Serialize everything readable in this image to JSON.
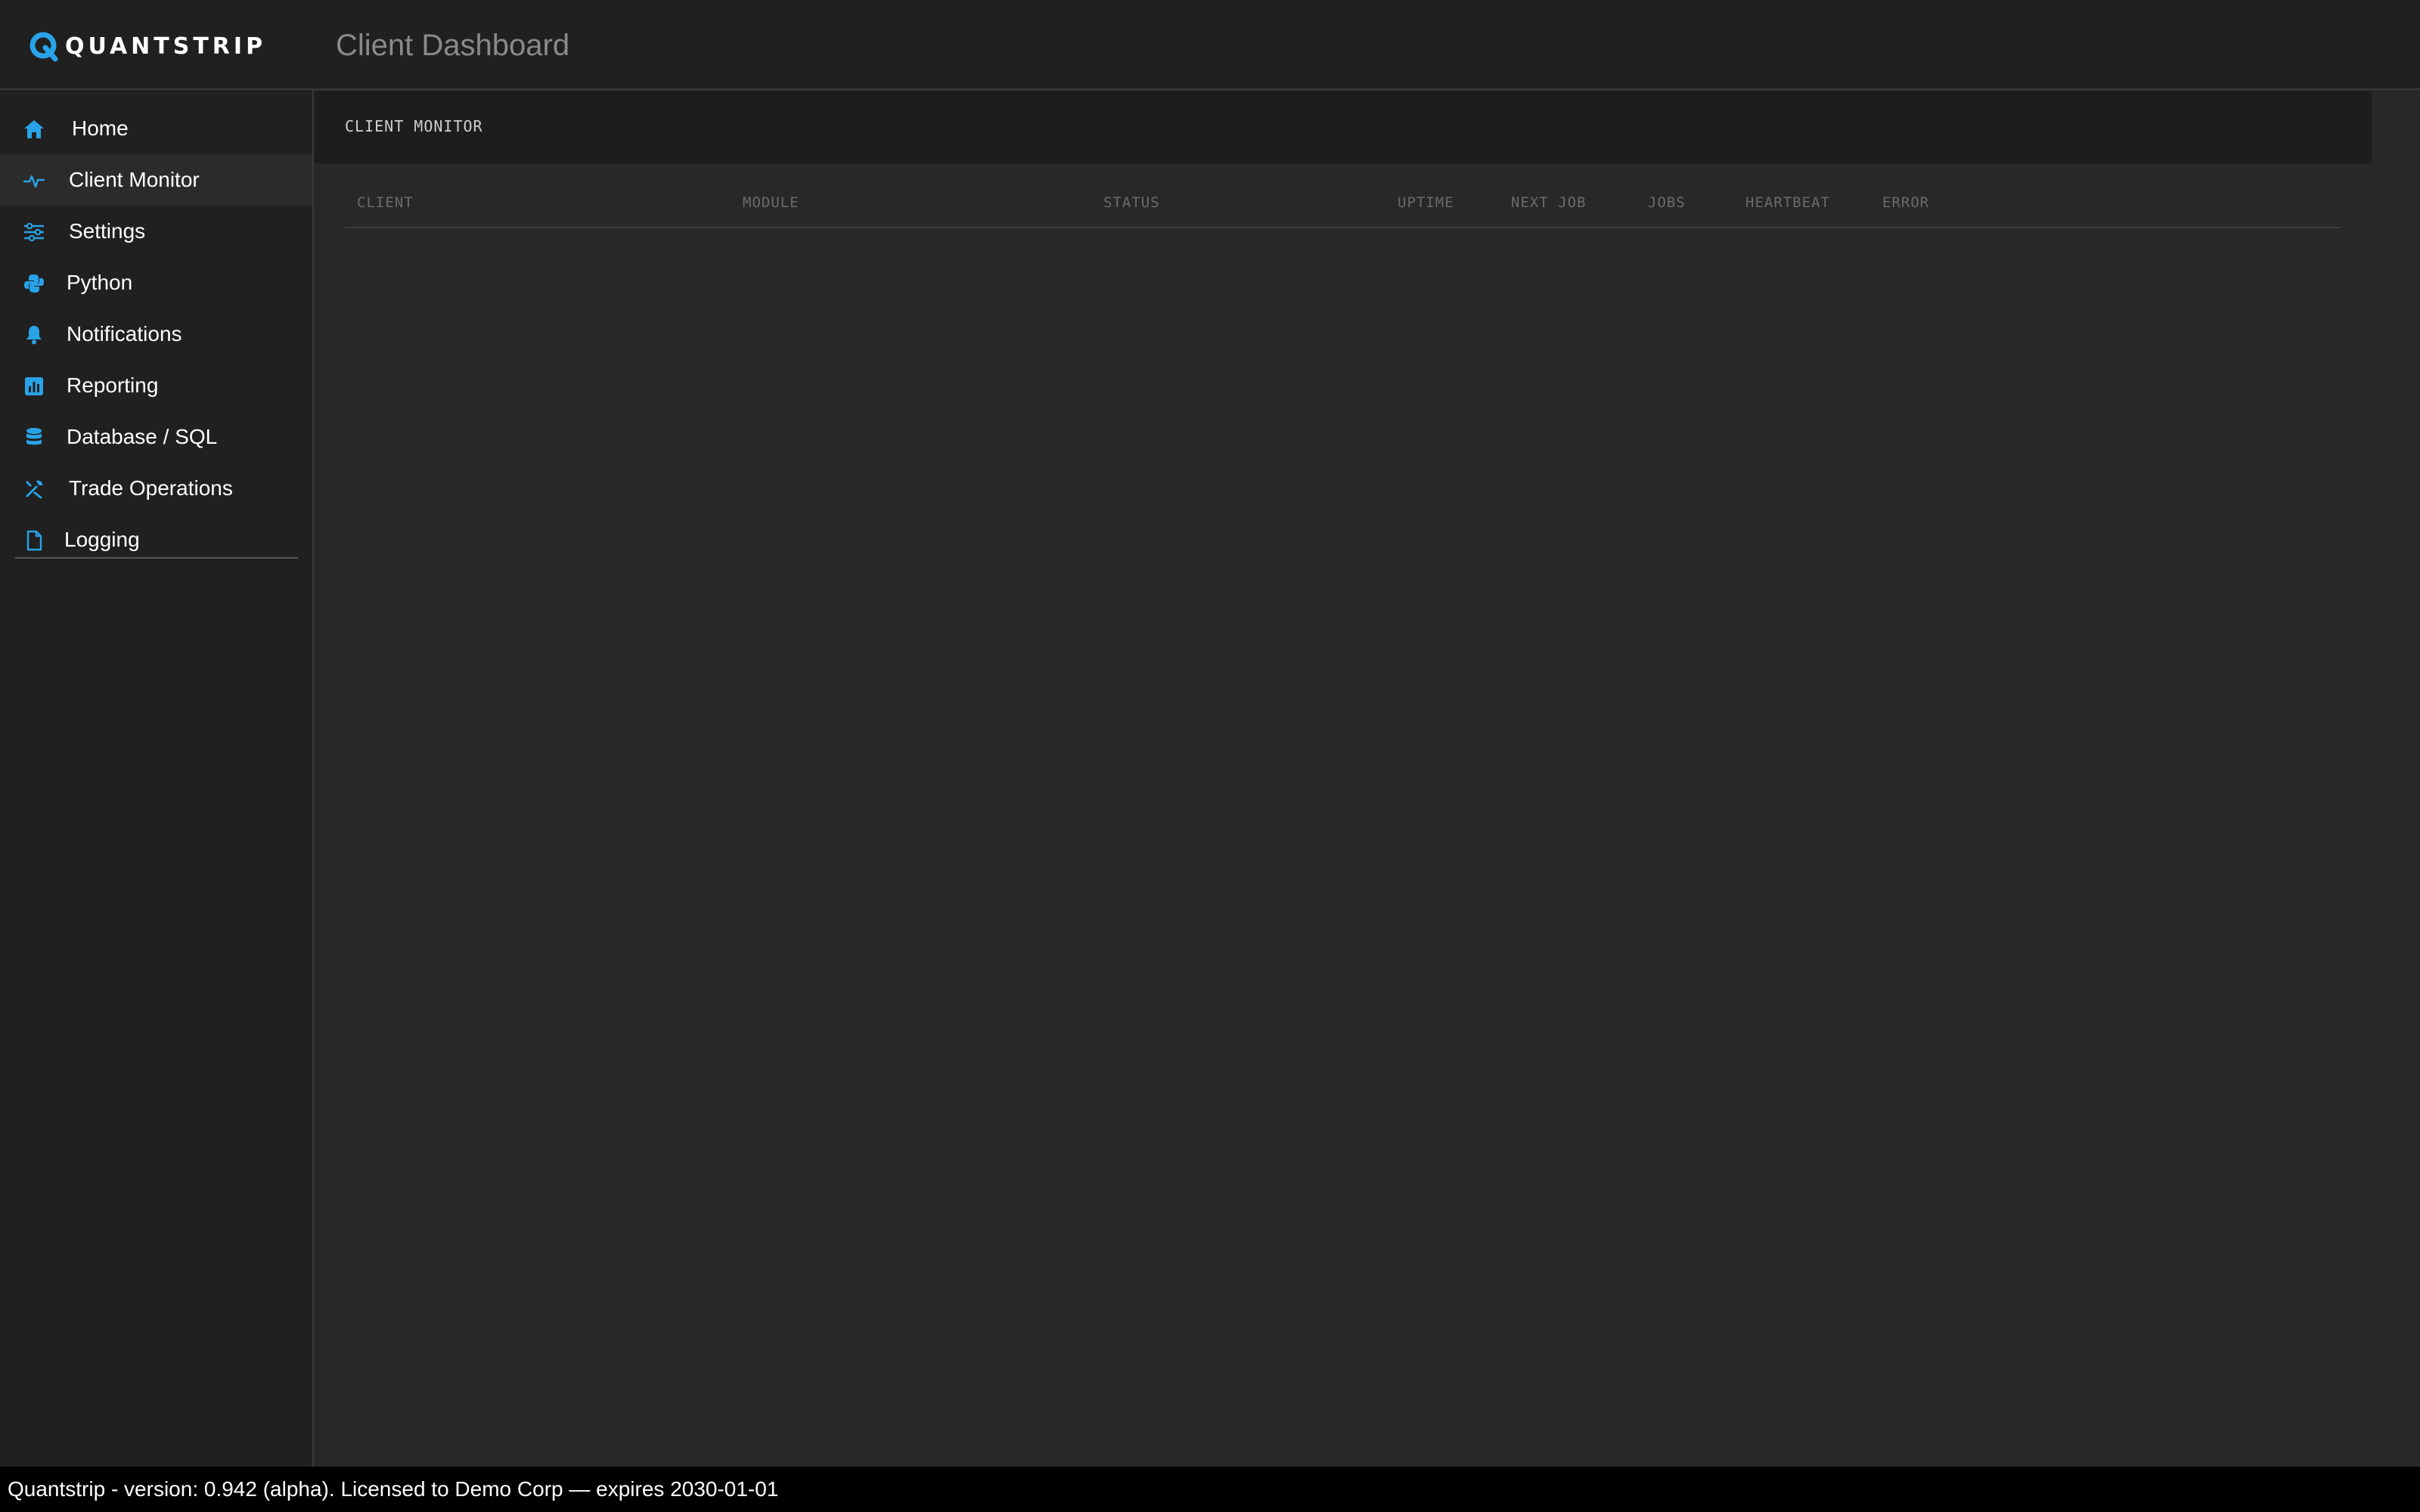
{
  "app": {
    "logo_text": "QUANTSTRIP",
    "page_title": "Client Dashboard",
    "accent_color": "#29a3e8"
  },
  "sidebar": {
    "items": [
      {
        "label": "Home",
        "icon": "home-icon",
        "active": false
      },
      {
        "label": "Client Monitor",
        "icon": "pulse-icon",
        "active": true
      },
      {
        "label": "Settings",
        "icon": "sliders-icon",
        "active": false
      },
      {
        "label": "Python",
        "icon": "python-icon",
        "active": false
      },
      {
        "label": "Notifications",
        "icon": "bell-icon",
        "active": false
      },
      {
        "label": "Reporting",
        "icon": "chart-icon",
        "active": false
      },
      {
        "label": "Database / SQL",
        "icon": "database-icon",
        "active": false
      },
      {
        "label": "Trade Operations",
        "icon": "tools-icon",
        "active": false
      },
      {
        "label": "Logging",
        "icon": "file-icon",
        "active": false
      }
    ]
  },
  "main": {
    "panel_title": "CLIENT MONITOR",
    "columns": [
      "CLIENT",
      "MODULE",
      "STATUS",
      "UPTIME",
      "NEXT JOB",
      "JOBS",
      "HEARTBEAT",
      "ERROR"
    ],
    "rows": []
  },
  "footer": {
    "text": "Quantstrip - version: 0.942 (alpha). Licensed to Demo Corp — expires 2030-01-01"
  }
}
